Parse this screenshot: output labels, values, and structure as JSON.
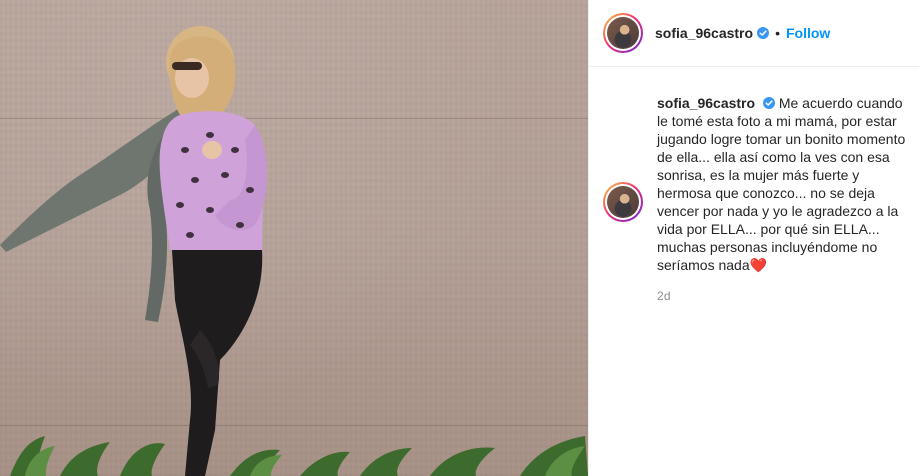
{
  "post": {
    "username": "sofia_96castro",
    "verified": true,
    "follow_label": "Follow",
    "separator": "•",
    "caption": "Me acuerdo cuando le tomé esta foto a mi mamá, por estar jugando logre tomar un bonito momento de ella... ella así como la ves con esa sonrisa, es la mujer más fuerte y hermosa que conozco... no se deja vencer por nada y yo le agradezco a la vida por ELLA... por qué sin ELLA... muchas personas incluyéndome no seríamos nada",
    "caption_emoji": "❤️",
    "time_ago": "2d"
  },
  "icons": {
    "verified": "verified-badge-icon",
    "avatar": "profile-avatar"
  },
  "colors": {
    "link_blue": "#0095f6",
    "verified_blue": "#3897f0",
    "text": "#262626",
    "muted": "#8e8e8e"
  }
}
